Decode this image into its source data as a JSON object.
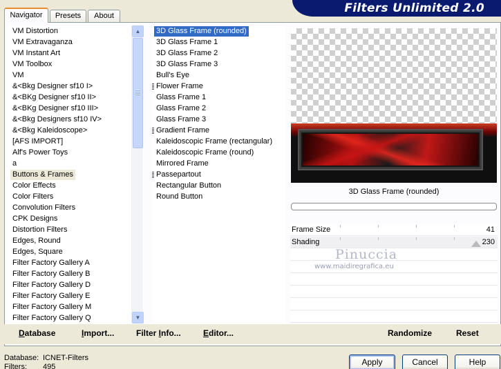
{
  "window": {
    "title": "Filters Unlimited 2.0"
  },
  "tabs": [
    {
      "label": "Navigator",
      "active": true
    },
    {
      "label": "Presets"
    },
    {
      "label": "About"
    }
  ],
  "categories": {
    "items": [
      "VM Distortion",
      "VM Extravaganza",
      "VM Instant Art",
      "VM Toolbox",
      "VM",
      "&<Bkg Designer sf10 I>",
      "&<BKg Designer sf10 II>",
      "&<BKg Designer sf10 III>",
      "&<Bkg Designers sf10 IV>",
      "&<Bkg Kaleidoscope>",
      "[AFS IMPORT]",
      "Alf's Power Toys",
      "a",
      "Buttons & Frames",
      "Color Effects",
      "Color Filters",
      "Convolution Filters",
      "CPK Designs",
      "Distortion Filters",
      "Edges, Round",
      "Edges, Square",
      "Filter Factory Gallery A",
      "Filter Factory Gallery B",
      "Filter Factory Gallery D",
      "Filter Factory Gallery E",
      "Filter Factory Gallery M",
      "Filter Factory Gallery Q"
    ],
    "selected_index": 13
  },
  "filters": {
    "items": [
      "3D Glass Frame (rounded)",
      "3D Glass Frame 1",
      "3D Glass Frame 2",
      "3D Glass Frame 3",
      "Bull's Eye",
      "Flower Frame",
      "Glass Frame 1",
      "Glass Frame 2",
      "Glass Frame 3",
      "Gradient Frame",
      "Kaleidoscopic Frame (rectangular)",
      "Kaleidoscopic Frame (round)",
      "Mirrored Frame",
      "Passepartout",
      "Rectangular Button",
      "Round Button"
    ],
    "selected_index": 0,
    "grip_indices": [
      5,
      9,
      13
    ]
  },
  "preview": {
    "filter_name": "3D Glass Frame (rounded)",
    "progress": 0
  },
  "params": [
    {
      "label": "Frame Size",
      "value": "41",
      "level": 41
    },
    {
      "label": "Shading",
      "value": "230",
      "level": 230
    }
  ],
  "watermark": {
    "name": "Pinuccia",
    "url": "www.maidiregrafica.eu"
  },
  "toolbar": {
    "database": {
      "u": "D",
      "rest": "atabase"
    },
    "import": {
      "u": "I",
      "rest": "mport..."
    },
    "filter_info": {
      "pre": "Filter ",
      "u": "I",
      "rest": "nfo..."
    },
    "editor": {
      "u": "E",
      "rest": "ditor..."
    },
    "randomize": "Randomize",
    "reset": "Reset"
  },
  "status": {
    "database_label": "Database:",
    "database_value": "ICNET-Filters",
    "filters_label": "Filters:",
    "filters_value": "495"
  },
  "buttons": {
    "apply": "Apply",
    "cancel": "Cancel",
    "help": "Help"
  }
}
